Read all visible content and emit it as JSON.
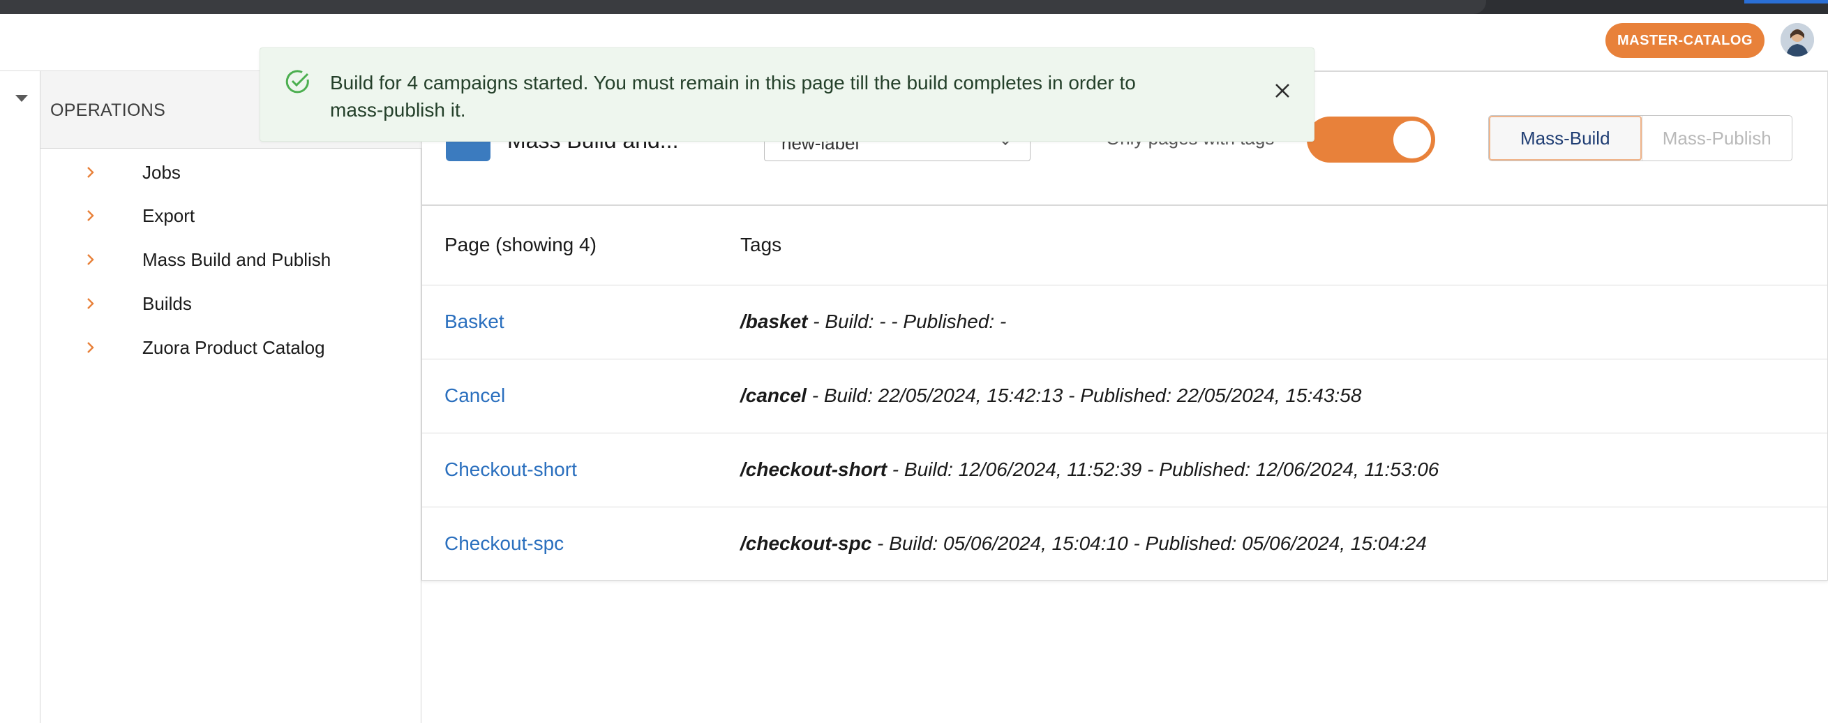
{
  "header": {
    "catalog_badge": "MASTER-CATALOG",
    "avatar_icon": "user-avatar-icon"
  },
  "sidebar": {
    "section_title": "OPERATIONS",
    "items": [
      {
        "label": "Jobs"
      },
      {
        "label": "Export"
      },
      {
        "label": "Mass Build and Publish"
      },
      {
        "label": "Builds"
      },
      {
        "label": "Zuora Product Catalog"
      }
    ]
  },
  "toolbar": {
    "campaign_name": "Mass Build and...",
    "label_select_value": "new-label",
    "toggle_label": "Only pages with tags",
    "toggle_on": true,
    "mass_build_label": "Mass-Build",
    "mass_publish_label": "Mass-Publish"
  },
  "table": {
    "columns": [
      "Page (showing 4)",
      "Tags"
    ],
    "rows": [
      {
        "page": "Basket",
        "slug": "/basket",
        "info": " - Build: - - Published: -"
      },
      {
        "page": "Cancel",
        "slug": "/cancel",
        "info": " - Build: 22/05/2024, 15:42:13 - Published: 22/05/2024, 15:43:58"
      },
      {
        "page": "Checkout-short",
        "slug": "/checkout-short",
        "info": " - Build: 12/06/2024, 11:52:39 - Published: 12/06/2024, 11:53:06"
      },
      {
        "page": "Checkout-spc",
        "slug": "/checkout-spc",
        "info": " - Build: 05/06/2024, 15:04:10 - Published: 05/06/2024, 15:04:24"
      }
    ]
  },
  "toast": {
    "message": "Build for 4 campaigns started. You must remain in this page till the build completes in order to mass-publish it.",
    "icon": "check-circle-icon",
    "close_icon": "close-icon"
  },
  "colors": {
    "accent": "#e8813a",
    "link": "#2a6fbe",
    "toast_bg": "#eef6ee",
    "success": "#4caf50"
  }
}
